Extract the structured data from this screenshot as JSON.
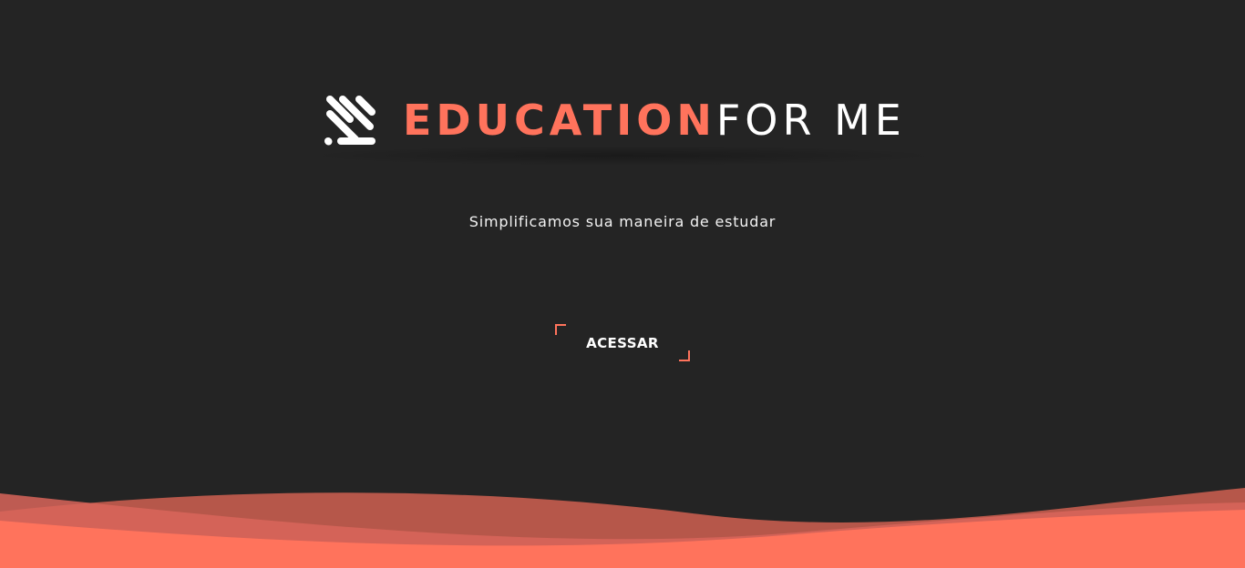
{
  "brand": {
    "logo_icon": "stripes-logo-icon",
    "name_part_a": "EDUCATION",
    "name_part_b": "FOR ME",
    "accent_color": "#ff735c"
  },
  "hero": {
    "tagline": "Simplificamos sua maneira de estudar"
  },
  "cta": {
    "label": "ACESSAR"
  },
  "theme": {
    "background": "#242424",
    "wave_colors": [
      "#b6574a",
      "#d9655a",
      "#ff735c"
    ]
  }
}
